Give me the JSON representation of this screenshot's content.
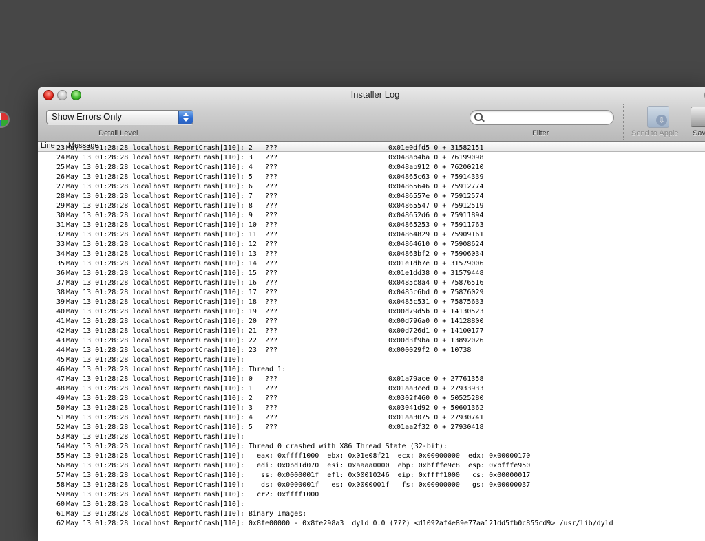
{
  "window": {
    "title": "Installer Log"
  },
  "toolbar": {
    "detail_select_value": "Show Errors Only",
    "detail_label": "Detail Level",
    "filter_label": "Filter",
    "filter_value": "",
    "send_label": "Send to Apple",
    "save_label": "Sav"
  },
  "columns": {
    "line": "Line",
    "message": "Message"
  },
  "log_rows": [
    {
      "line": "23",
      "message": "May 13 01:28:28 localhost ReportCrash[110]: 2   ???",
      "offset": "0x01e0dfd5 0 + 31582151"
    },
    {
      "line": "24",
      "message": "May 13 01:28:28 localhost ReportCrash[110]: 3   ???",
      "offset": "0x048ab4ba 0 + 76199098"
    },
    {
      "line": "25",
      "message": "May 13 01:28:28 localhost ReportCrash[110]: 4   ???",
      "offset": "0x048ab912 0 + 76200210"
    },
    {
      "line": "26",
      "message": "May 13 01:28:28 localhost ReportCrash[110]: 5   ???",
      "offset": "0x04865c63 0 + 75914339"
    },
    {
      "line": "27",
      "message": "May 13 01:28:28 localhost ReportCrash[110]: 6   ???",
      "offset": "0x04865646 0 + 75912774"
    },
    {
      "line": "28",
      "message": "May 13 01:28:28 localhost ReportCrash[110]: 7   ???",
      "offset": "0x0486557e 0 + 75912574"
    },
    {
      "line": "29",
      "message": "May 13 01:28:28 localhost ReportCrash[110]: 8   ???",
      "offset": "0x04865547 0 + 75912519"
    },
    {
      "line": "30",
      "message": "May 13 01:28:28 localhost ReportCrash[110]: 9   ???",
      "offset": "0x048652d6 0 + 75911894"
    },
    {
      "line": "31",
      "message": "May 13 01:28:28 localhost ReportCrash[110]: 10  ???",
      "offset": "0x04865253 0 + 75911763"
    },
    {
      "line": "32",
      "message": "May 13 01:28:28 localhost ReportCrash[110]: 11  ???",
      "offset": "0x04864829 0 + 75909161"
    },
    {
      "line": "33",
      "message": "May 13 01:28:28 localhost ReportCrash[110]: 12  ???",
      "offset": "0x04864610 0 + 75908624"
    },
    {
      "line": "34",
      "message": "May 13 01:28:28 localhost ReportCrash[110]: 13  ???",
      "offset": "0x04863bf2 0 + 75906034"
    },
    {
      "line": "35",
      "message": "May 13 01:28:28 localhost ReportCrash[110]: 14  ???",
      "offset": "0x01e1db7e 0 + 31579006"
    },
    {
      "line": "36",
      "message": "May 13 01:28:28 localhost ReportCrash[110]: 15  ???",
      "offset": "0x01e1dd38 0 + 31579448"
    },
    {
      "line": "37",
      "message": "May 13 01:28:28 localhost ReportCrash[110]: 16  ???",
      "offset": "0x0485c8a4 0 + 75876516"
    },
    {
      "line": "38",
      "message": "May 13 01:28:28 localhost ReportCrash[110]: 17  ???",
      "offset": "0x0485c6bd 0 + 75876029"
    },
    {
      "line": "39",
      "message": "May 13 01:28:28 localhost ReportCrash[110]: 18  ???",
      "offset": "0x0485c531 0 + 75875633"
    },
    {
      "line": "40",
      "message": "May 13 01:28:28 localhost ReportCrash[110]: 19  ???",
      "offset": "0x00d79d5b 0 + 14130523"
    },
    {
      "line": "41",
      "message": "May 13 01:28:28 localhost ReportCrash[110]: 20  ???",
      "offset": "0x00d796a0 0 + 14128800"
    },
    {
      "line": "42",
      "message": "May 13 01:28:28 localhost ReportCrash[110]: 21  ???",
      "offset": "0x00d726d1 0 + 14100177"
    },
    {
      "line": "43",
      "message": "May 13 01:28:28 localhost ReportCrash[110]: 22  ???",
      "offset": "0x00d3f9ba 0 + 13892026"
    },
    {
      "line": "44",
      "message": "May 13 01:28:28 localhost ReportCrash[110]: 23  ???",
      "offset": "0x000029f2 0 + 10738"
    },
    {
      "line": "45",
      "message": "May 13 01:28:28 localhost ReportCrash[110]:",
      "offset": ""
    },
    {
      "line": "46",
      "message": "May 13 01:28:28 localhost ReportCrash[110]: Thread 1:",
      "offset": ""
    },
    {
      "line": "47",
      "message": "May 13 01:28:28 localhost ReportCrash[110]: 0   ???",
      "offset": "0x01a79ace 0 + 27761358"
    },
    {
      "line": "48",
      "message": "May 13 01:28:28 localhost ReportCrash[110]: 1   ???",
      "offset": "0x01aa3ced 0 + 27933933"
    },
    {
      "line": "49",
      "message": "May 13 01:28:28 localhost ReportCrash[110]: 2   ???",
      "offset": "0x0302f460 0 + 50525280"
    },
    {
      "line": "50",
      "message": "May 13 01:28:28 localhost ReportCrash[110]: 3   ???",
      "offset": "0x03041d92 0 + 50601362"
    },
    {
      "line": "51",
      "message": "May 13 01:28:28 localhost ReportCrash[110]: 4   ???",
      "offset": "0x01aa3075 0 + 27930741"
    },
    {
      "line": "52",
      "message": "May 13 01:28:28 localhost ReportCrash[110]: 5   ???",
      "offset": "0x01aa2f32 0 + 27930418"
    },
    {
      "line": "53",
      "message": "May 13 01:28:28 localhost ReportCrash[110]:",
      "offset": ""
    },
    {
      "line": "54",
      "message": "May 13 01:28:28 localhost ReportCrash[110]: Thread 0 crashed with X86 Thread State (32-bit):",
      "offset": ""
    },
    {
      "line": "55",
      "message": "May 13 01:28:28 localhost ReportCrash[110]:   eax: 0xffff1000  ebx: 0x01e08f21  ecx: 0x00000000  edx: 0x00000170",
      "offset": ""
    },
    {
      "line": "56",
      "message": "May 13 01:28:28 localhost ReportCrash[110]:   edi: 0x0bd1d070  esi: 0xaaaa0000  ebp: 0xbfffe9c8  esp: 0xbfffe950",
      "offset": ""
    },
    {
      "line": "57",
      "message": "May 13 01:28:28 localhost ReportCrash[110]:    ss: 0x0000001f  efl: 0x00010246  eip: 0xffff1000   cs: 0x00000017",
      "offset": ""
    },
    {
      "line": "58",
      "message": "May 13 01:28:28 localhost ReportCrash[110]:    ds: 0x0000001f   es: 0x0000001f   fs: 0x00000000   gs: 0x00000037",
      "offset": ""
    },
    {
      "line": "59",
      "message": "May 13 01:28:28 localhost ReportCrash[110]:   cr2: 0xffff1000",
      "offset": ""
    },
    {
      "line": "60",
      "message": "May 13 01:28:28 localhost ReportCrash[110]:",
      "offset": ""
    },
    {
      "line": "61",
      "message": "May 13 01:28:28 localhost ReportCrash[110]: Binary Images:",
      "offset": ""
    },
    {
      "line": "62",
      "message": "May 13 01:28:28 localhost ReportCrash[110]: 0x8fe00000 - 0x8fe298a3  dyld 0.0 (???) <d1092af4e89e77aa121dd5fb0c855cd9> /usr/lib/dyld",
      "offset": ""
    }
  ]
}
